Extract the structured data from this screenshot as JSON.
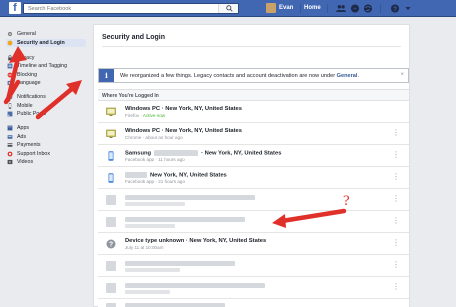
{
  "topbar": {
    "logo": "f",
    "search_placeholder": "Search Facebook",
    "user_name": "Evan",
    "home_label": "Home"
  },
  "sidebar": {
    "groups": [
      [
        {
          "label": "General",
          "icon": "gear-icon"
        },
        {
          "label": "Security and Login",
          "icon": "shield-icon",
          "active": true
        }
      ],
      [
        {
          "label": "Privacy",
          "icon": "lock-icon"
        },
        {
          "label": "Timeline and Tagging",
          "icon": "timeline-icon"
        },
        {
          "label": "Blocking",
          "icon": "blocking-icon"
        },
        {
          "label": "Language",
          "icon": "language-icon"
        }
      ],
      [
        {
          "label": "Notifications",
          "icon": "globe-icon"
        },
        {
          "label": "Mobile",
          "icon": "mobile-icon"
        },
        {
          "label": "Public Posts",
          "icon": "rss-icon"
        }
      ],
      [
        {
          "label": "Apps",
          "icon": "apps-icon"
        },
        {
          "label": "Ads",
          "icon": "ads-icon"
        },
        {
          "label": "Payments",
          "icon": "payments-icon"
        },
        {
          "label": "Support Inbox",
          "icon": "support-icon"
        },
        {
          "label": "Videos",
          "icon": "videos-icon"
        }
      ]
    ]
  },
  "main": {
    "title": "Security and Login",
    "notice": {
      "icon": "i",
      "text": "We reorganized a few things. Legacy contacts and account deactivation are now under ",
      "link": "General",
      "period": ".",
      "close": "×"
    },
    "section_title": "Where You're Logged In",
    "sessions": [
      {
        "title": "Windows PC · New York, NY, United States",
        "sub": "Firefox · ",
        "status": "Active now",
        "icon": "monitor-icon"
      },
      {
        "title": "Windows PC · New York, NY, United States",
        "sub": "Chrome · about an hour ago",
        "icon": "monitor-icon"
      },
      {
        "title": "Samsung",
        "title_tail": "· New York, NY, United States",
        "sub": "Facebook app · 11 hours ago",
        "icon": "phone-icon"
      },
      {
        "title_tail": "New York, NY, United States",
        "sub": "Facebook app · 21 hours ago",
        "icon": "phone-icon"
      },
      {
        "title": "Device type unknown · New York, NY, United States",
        "sub": "July 11 at 10:00am",
        "icon": "question-icon"
      }
    ],
    "annotation_mark": "?"
  },
  "colors": {
    "brand": "#4267b2",
    "arrow": "#e0302a",
    "active_status": "#42b72a"
  }
}
